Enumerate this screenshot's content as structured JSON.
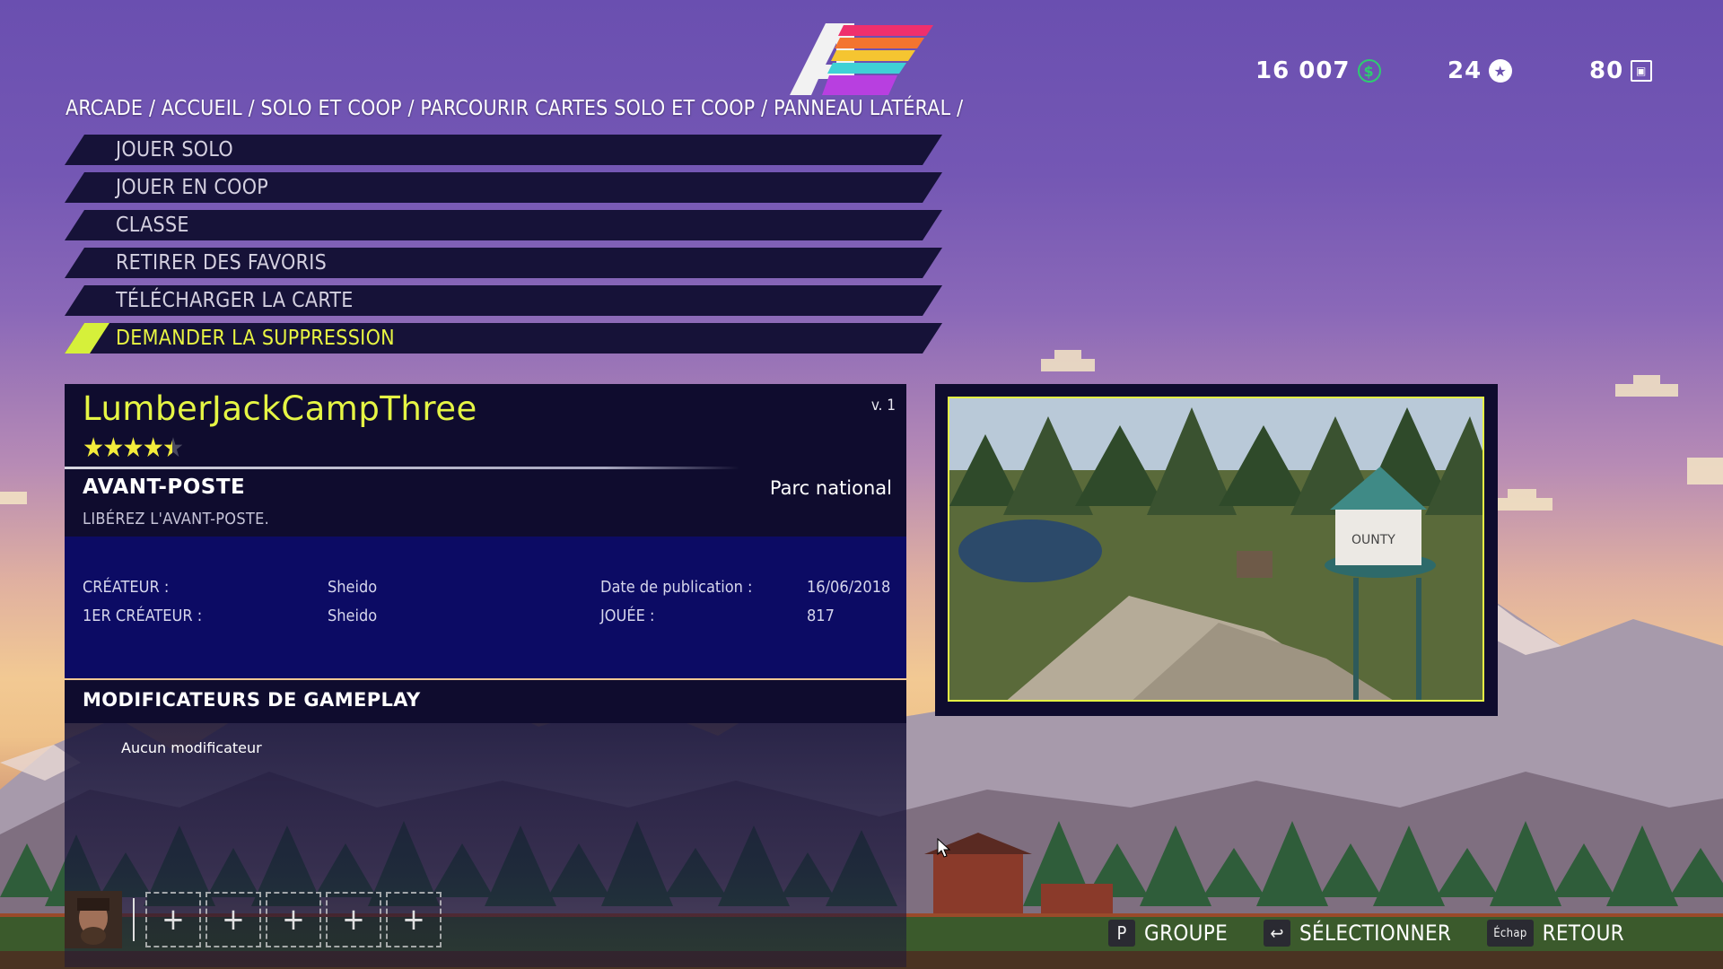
{
  "breadcrumb": "ARCADE / ACCUEIL / SOLO ET COOP / PARCOURIR CARTES SOLO ET COOP / PANNEAU LATÉRAL /",
  "currency": [
    {
      "value": "16 007",
      "icon": "dollar-coin-icon",
      "color": "#2ecc71"
    },
    {
      "value": "24",
      "icon": "star-badge-icon",
      "color": "#ffffff"
    },
    {
      "value": "80",
      "icon": "map-tile-icon",
      "color": "#ffffff"
    }
  ],
  "menu": [
    {
      "label": "JOUER SOLO",
      "active": false
    },
    {
      "label": "JOUER EN COOP",
      "active": false
    },
    {
      "label": "CLASSE",
      "active": false
    },
    {
      "label": "RETIRER DES FAVORIS",
      "active": false
    },
    {
      "label": "TÉLÉCHARGER LA CARTE",
      "active": false
    },
    {
      "label": "DEMANDER LA SUPPRESSION",
      "active": true
    }
  ],
  "map": {
    "name": "LumberJackCampThree",
    "version": "v. 1",
    "rating": 4.5,
    "rating_max": 5,
    "mode": "AVANT-POSTE",
    "mode_desc": "LIBÉREZ L'AVANT-POSTE.",
    "region": "Parc national"
  },
  "info": {
    "creator_label": "CRÉATEUR :",
    "creator": "Sheido",
    "first_creator_label": "1ER CRÉATEUR :",
    "first_creator": "Sheido",
    "date_label": "Date de publication :",
    "date": "16/06/2018",
    "played_label": "JOUÉE :",
    "played": "817"
  },
  "modifiers": {
    "title": "MODIFICATEURS DE GAMEPLAY",
    "empty_text": "Aucun modificateur"
  },
  "party": {
    "empty_slot_glyph": "+",
    "empty_slots": 5
  },
  "prompts": [
    {
      "key": "P",
      "label": "GROUPE"
    },
    {
      "key": "↩",
      "label": "SÉLECTIONNER"
    },
    {
      "key": "Échap",
      "label": "RETOUR"
    }
  ],
  "colors": {
    "accent": "#e5f544",
    "panel_dark": "#0f0c2e",
    "panel_blue": "#0c0b64"
  }
}
